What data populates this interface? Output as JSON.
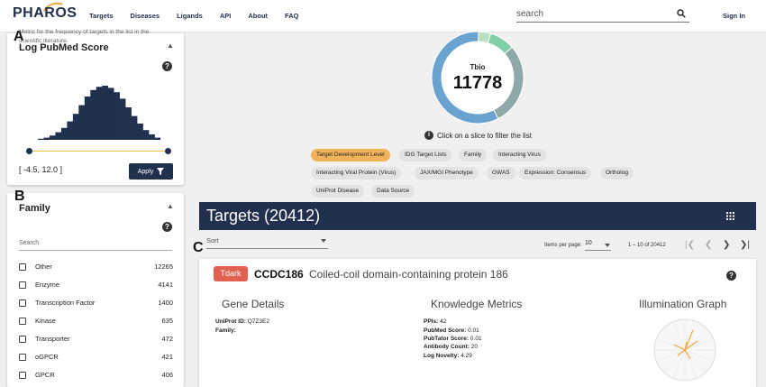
{
  "nav": {
    "logo": "PHAROS",
    "items": [
      "Targets",
      "Diseases",
      "Ligands",
      "API",
      "About",
      "FAQ"
    ],
    "search_placeholder": "search",
    "signin": "Sign In"
  },
  "panel_letters": {
    "a": "A",
    "b": "B",
    "c": "C"
  },
  "pubmed_filter": {
    "title": "Log PubMed Score",
    "description": "Metric for the frequency of targets in the list in the scientific literature.",
    "histogram": [
      1,
      2,
      4,
      7,
      11,
      17,
      24,
      32,
      40,
      46,
      49,
      50,
      48,
      44,
      38,
      30,
      22,
      15,
      9,
      5,
      2
    ],
    "range_text": "[ -4.5, 12.0 ]",
    "apply_label": "Apply"
  },
  "family_filter": {
    "title": "Family",
    "search_label": "Search",
    "items": [
      {
        "label": "Other",
        "count": "12265"
      },
      {
        "label": "Enzyme",
        "count": "4141"
      },
      {
        "label": "Transcription Factor",
        "count": "1400"
      },
      {
        "label": "Kinase",
        "count": "635"
      },
      {
        "label": "Transporter",
        "count": "472"
      },
      {
        "label": "oGPCR",
        "count": "421"
      },
      {
        "label": "GPCR",
        "count": "406"
      }
    ]
  },
  "donut": {
    "label": "Tbio",
    "count": "11778",
    "hint": "Click on a slice to filter the list",
    "slices": [
      {
        "name": "Tbio",
        "fraction": 0.577,
        "color": "#6aa3d0"
      },
      {
        "name": "Tdark",
        "fraction": 0.291,
        "color": "#8fa8a9"
      },
      {
        "name": "Tchem",
        "fraction": 0.089,
        "color": "#7fd0a8"
      },
      {
        "name": "Tclin",
        "fraction": 0.043,
        "color": "#b9e0c0"
      }
    ]
  },
  "chips": {
    "c0": "Target Development Level",
    "c1": "IDG Target Lists",
    "c2": "Family",
    "c3": "Interacting Virus",
    "c4": "Interacting Viral Protein (Virus)",
    "c5": "JAX/MGI Phenotype",
    "c6": "GWAS",
    "c7": "Expression: Consensus",
    "c8": "Ortholog",
    "c9": "UniProt Disease",
    "c10": "Data Source"
  },
  "targets": {
    "title": "Targets (20412)",
    "sort_label": "Sort",
    "items_per_page_label": "Items per page:",
    "items_per_page": "10",
    "range": "1 – 10 of 20412"
  },
  "target": {
    "tdl": "Tdark",
    "symbol": "CCDC186",
    "name": "Coiled-coil domain-containing protein 186",
    "gene_details_title": "Gene Details",
    "uniprot_label": "UniProt ID:",
    "uniprot_value": "Q7Z3E2",
    "family_label": "Family:",
    "knowledge_title": "Knowledge Metrics",
    "metrics": {
      "ppis_label": "PPIs:",
      "ppis": "42",
      "pubmed_label": "PubMed Score:",
      "pubmed": "0.01",
      "pubtator_label": "PubTator Score:",
      "pubtator": "0.01",
      "antibody_label": "Antibody Count:",
      "antibody": "20",
      "novelty_label": "Log Novelty:",
      "novelty": "4.29"
    },
    "illumination_title": "Illumination Graph"
  },
  "colors": {
    "navy": "#22304f",
    "accent": "#f2b45a",
    "tdark": "#e06150"
  }
}
